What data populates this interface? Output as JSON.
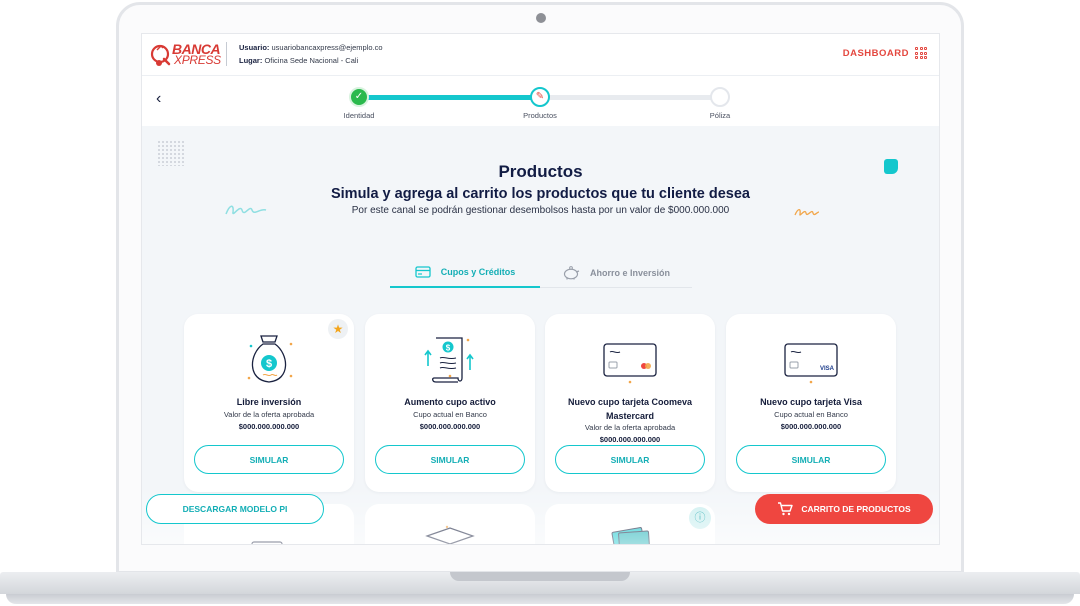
{
  "header": {
    "logo_line1": "BANCA",
    "logo_line2": "XPRESS",
    "user_label": "Usuario:",
    "user_value": "usuariobancaxpress@ejemplo.co",
    "place_label": "Lugar:",
    "place_value": "Oficina Sede Nacional - Cali",
    "dashboard_label": "DASHBOARD"
  },
  "stepper": {
    "steps": [
      {
        "label": "Identidad",
        "state": "done"
      },
      {
        "label": "Productos",
        "state": "current"
      },
      {
        "label": "Póliza",
        "state": "pending"
      }
    ]
  },
  "hero": {
    "title": "Productos",
    "subtitle": "Simula y agrega al carrito los productos que tu cliente desea",
    "note": "Por este canal se podrán gestionar desembolsos hasta por un valor de $000.000.000"
  },
  "tabs": [
    {
      "label": "Cupos y Créditos",
      "icon": "credit-card-icon",
      "active": true
    },
    {
      "label": "Ahorro e Inversión",
      "icon": "piggy-bank-icon",
      "active": false
    }
  ],
  "cards": [
    {
      "title": "Libre inversión",
      "subtitle": "Valor de la oferta aprobada",
      "value": "$000.000.000.000",
      "button": "SIMULAR",
      "icon": "money-bag-icon",
      "featured": true
    },
    {
      "title": "Aumento cupo activo",
      "subtitle": "Cupo actual en Banco",
      "value": "$000.000.000.000",
      "button": "SIMULAR",
      "icon": "document-increase-icon",
      "featured": false
    },
    {
      "title": "Nuevo cupo tarjeta Coomeva Mastercard",
      "subtitle": "Valor de la oferta aprobada",
      "value": "$000.000.000.000",
      "button": "SIMULAR",
      "icon": "mastercard-card-icon",
      "featured": false
    },
    {
      "title": "Nuevo cupo tarjeta Visa",
      "subtitle": "Cupo actual en Banco",
      "value": "$000.000.000.000",
      "button": "SIMULAR",
      "icon": "visa-card-icon",
      "featured": false
    }
  ],
  "card_brand_text": "VISA",
  "footer": {
    "download_label": "DESCARGAR MODELO PI",
    "cart_label": "CARRITO DE PRODUCTOS"
  },
  "colors": {
    "accent": "#14c7cd",
    "brand_red": "#ef4640",
    "navy": "#121c44",
    "success": "#2bb94d"
  }
}
